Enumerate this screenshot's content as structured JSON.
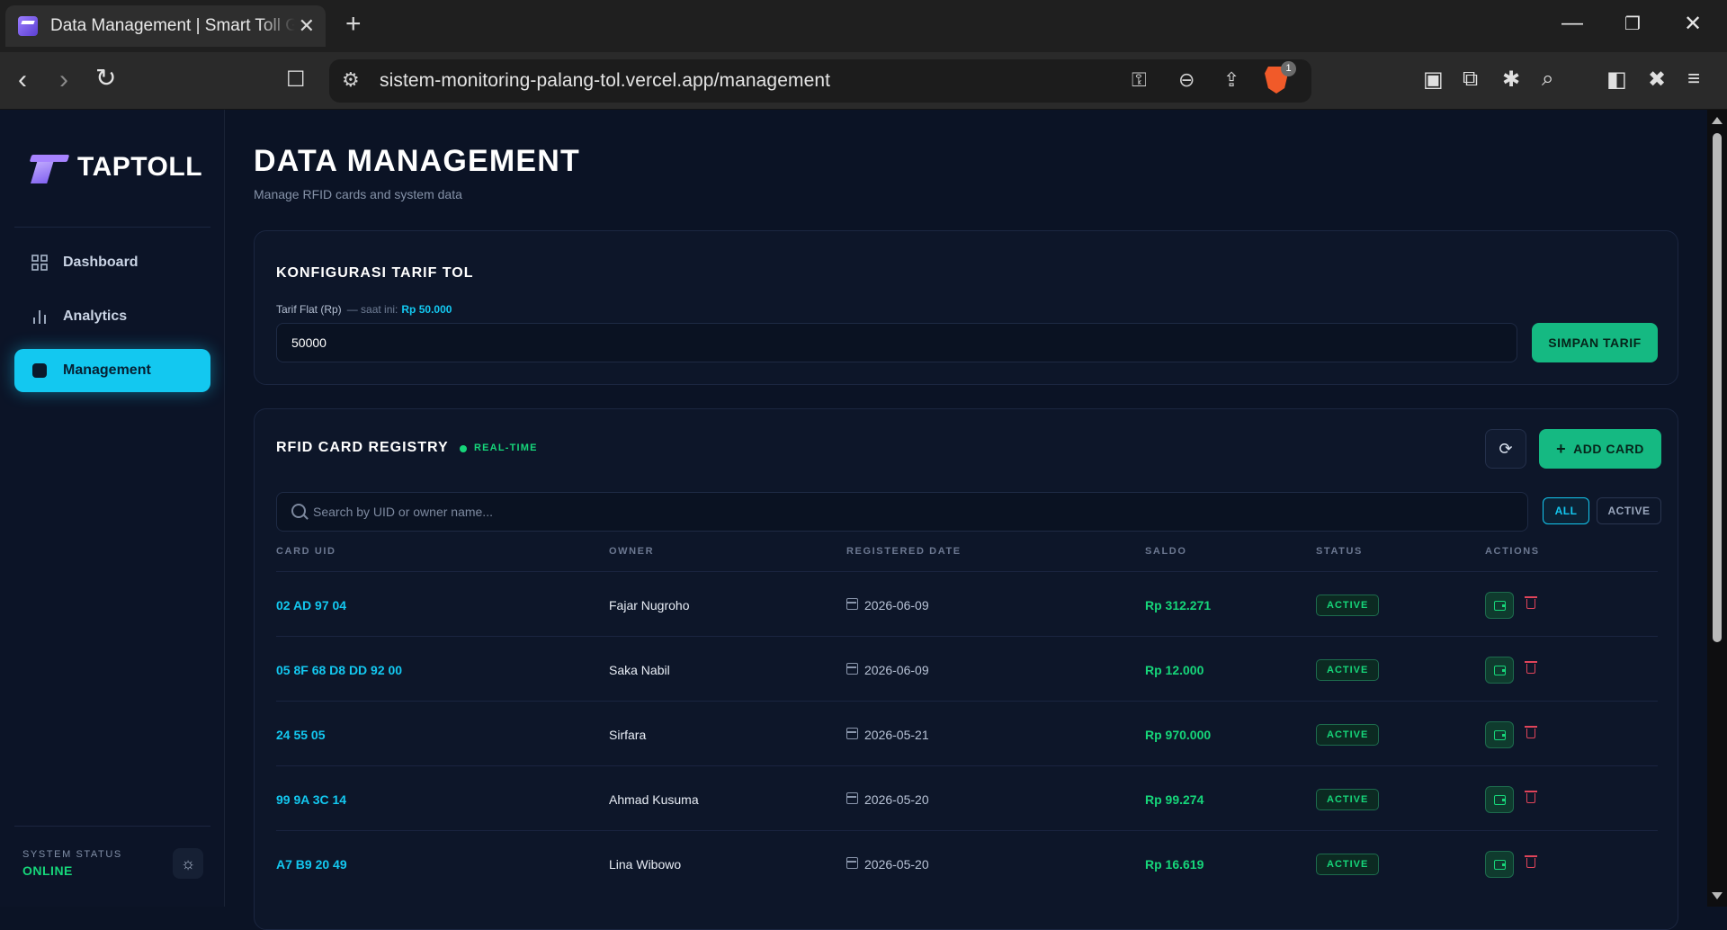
{
  "browser": {
    "tab_title": "Data Management | Smart Toll Gate",
    "url": "sistem-monitoring-palang-tol.vercel.app/management",
    "brave_badge": "1"
  },
  "sidebar": {
    "brand": "TAPTOLL",
    "items": [
      {
        "label": "Dashboard",
        "icon": "grid-icon",
        "active": false
      },
      {
        "label": "Analytics",
        "icon": "bar-chart-icon",
        "active": false
      },
      {
        "label": "Management",
        "icon": "square-icon",
        "active": true
      }
    ],
    "system_status_label": "SYSTEM STATUS",
    "system_status_value": "ONLINE"
  },
  "page": {
    "title": "DATA MANAGEMENT",
    "subtitle": "Manage RFID cards and system data"
  },
  "tarif": {
    "title": "KONFIGURASI TARIF TOL",
    "label": "Tarif Flat (Rp)",
    "current_prefix": "— saat ini:",
    "current_value": "Rp 50.000",
    "input_value": "50000",
    "save_label": "SIMPAN TARIF"
  },
  "registry": {
    "title": "RFID CARD REGISTRY",
    "live_label": "REAL-TIME",
    "add_label": "ADD CARD",
    "search_placeholder": "Search by UID or owner name...",
    "filters": {
      "all": "ALL",
      "active": "ACTIVE"
    },
    "columns": [
      "CARD UID",
      "OWNER",
      "REGISTERED DATE",
      "SALDO",
      "STATUS",
      "ACTIONS"
    ],
    "rows": [
      {
        "uid": "02 AD 97 04",
        "owner": "Fajar Nugroho",
        "date": "2026-06-09",
        "saldo": "Rp 312.271",
        "status": "ACTIVE"
      },
      {
        "uid": "05 8F 68 D8 DD 92 00",
        "owner": "Saka Nabil",
        "date": "2026-06-09",
        "saldo": "Rp 12.000",
        "status": "ACTIVE"
      },
      {
        "uid": "24 55 05",
        "owner": "Sirfara",
        "date": "2026-05-21",
        "saldo": "Rp 970.000",
        "status": "ACTIVE"
      },
      {
        "uid": "99 9A 3C 14",
        "owner": "Ahmad Kusuma",
        "date": "2026-05-20",
        "saldo": "Rp 99.274",
        "status": "ACTIVE"
      },
      {
        "uid": "A7 B9 20 49",
        "owner": "Lina Wibowo",
        "date": "2026-05-20",
        "saldo": "Rp 16.619",
        "status": "ACTIVE"
      }
    ]
  },
  "colors": {
    "accent": "#13c8f0",
    "success": "#16d67a",
    "danger": "#e0445a",
    "background": "#0b1325"
  }
}
